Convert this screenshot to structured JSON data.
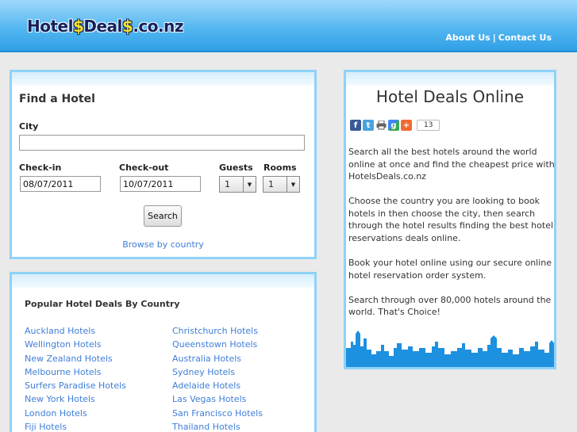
{
  "header": {
    "logo": {
      "part1": "Hotel",
      "sym1": "$",
      "part2": "Deal",
      "sym2": "$",
      "part3": ".co.nz"
    },
    "nav": {
      "about": "About Us",
      "sep": "|",
      "contact": "Contact Us"
    }
  },
  "find_hotel": {
    "title": "Find a Hotel",
    "city_label": "City",
    "city_value": "",
    "checkin_label": "Check-in",
    "checkin_value": "08/07/2011",
    "checkout_label": "Check-out",
    "checkout_value": "10/07/2011",
    "guests_label": "Guests",
    "guests_value": "1",
    "rooms_label": "Rooms",
    "rooms_value": "1",
    "search_label": "Search",
    "browse_label": "Browse by country"
  },
  "countries": {
    "title": "Popular Hotel Deals By Country",
    "left": [
      "Auckland Hotels",
      "Wellington Hotels",
      "New Zealand Hotels",
      "Melbourne Hotels",
      "Surfers Paradise Hotels",
      "New York Hotels",
      "London Hotels",
      "Fiji Hotels"
    ],
    "right": [
      "Christchurch Hotels",
      "Queenstown Hotels",
      "Australia Hotels",
      "Sydney Hotels",
      "Adelaide Hotels",
      "Las Vegas Hotels",
      "San Francisco Hotels",
      "Thailand Hotels"
    ]
  },
  "deals": {
    "title": "Hotel Deals Online",
    "share_count": "13",
    "share_icons": [
      "facebook-icon",
      "twitter-icon",
      "print-icon",
      "google-icon",
      "addthis-icon"
    ],
    "paragraphs": [
      "Search all the best hotels around the world online at once and find the cheapest price with HotelsDeals.co.nz",
      "Choose the country you are looking to book hotels in then choose the city, then search through the hotel results finding the best hotel reservations deals online.",
      "Book your hotel online using our secure online hotel reservation order system.",
      "Search through over 80,000 hotels around the world. That's Choice!"
    ]
  },
  "colors": {
    "accent": "#2f9fe6",
    "link": "#3f7ed8",
    "panel_border": "#8fd2f7",
    "logo_dark": "#16215a",
    "logo_gold": "#f4e12c"
  }
}
